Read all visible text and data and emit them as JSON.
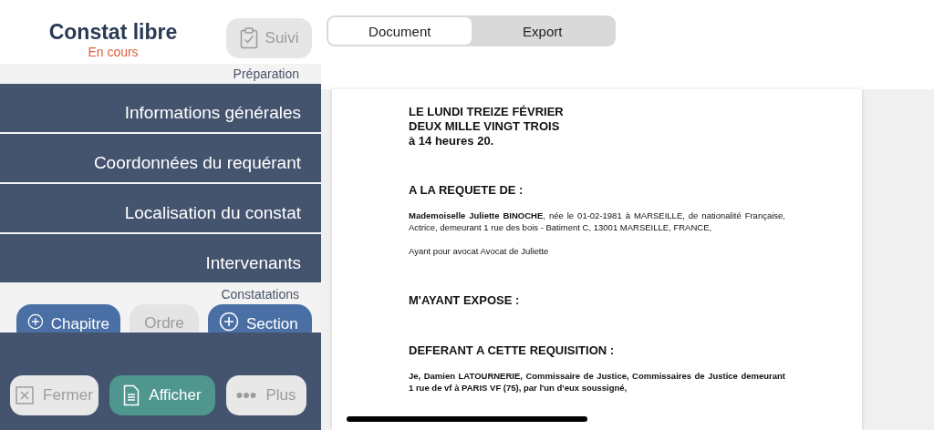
{
  "header": {
    "title": "Constat libre",
    "status": "En cours",
    "suivi_button": "Suivi"
  },
  "tabs": [
    {
      "label": "Document",
      "selected": true
    },
    {
      "label": "Export",
      "selected": false
    }
  ],
  "sidebar": {
    "section_label": "Préparation",
    "items": [
      "Informations générales",
      "Coordonnées du requérant",
      "Localisation du constat",
      "Intervenants"
    ],
    "constatations_label": "Constatations",
    "constatations_buttons": [
      {
        "label": "Chapitre",
        "kind": "add"
      },
      {
        "label": "Ordre",
        "kind": "plain"
      },
      {
        "label": "Section",
        "kind": "add"
      }
    ],
    "footer_buttons": [
      {
        "label": "Fermer",
        "kind": "close"
      },
      {
        "label": "Afficher",
        "kind": "view"
      },
      {
        "label": "Plus",
        "kind": "more"
      }
    ]
  },
  "document": [
    {
      "kind": "heading",
      "lines": [
        "LE LUNDI TREIZE FÉVRIER",
        "DEUX MILLE VINGT TROIS",
        "à 14 heures 20."
      ]
    },
    {
      "kind": "section",
      "lines": [
        "A LA REQUETE DE :"
      ]
    },
    {
      "kind": "paragraph",
      "bold": false,
      "text": "**Mademoiselle Juliette BINOCHE**, née le 01-02-1981 à MARSEILLE, de nationalité Française, Actrice, demeurant 1 rue des bois - Batiment C, 13001 MARSEILLE, FRANCE,"
    },
    {
      "kind": "paragraph",
      "bold": false,
      "text": "Ayant pour avocat Avocat de Juliette"
    },
    {
      "kind": "section",
      "lines": [
        "M'AYANT EXPOSE :"
      ]
    },
    {
      "kind": "section",
      "lines": [
        "DEFERANT A CETTE REQUISITION :"
      ]
    },
    {
      "kind": "paragraph",
      "bold": true,
      "text": "Je, Damien LATOURNERIE, Commissaire de Justice, Commissaires de Justice demeurant 1 rue de vf à PARIS VF (75), par l'un d'eux soussigné,"
    }
  ]
}
